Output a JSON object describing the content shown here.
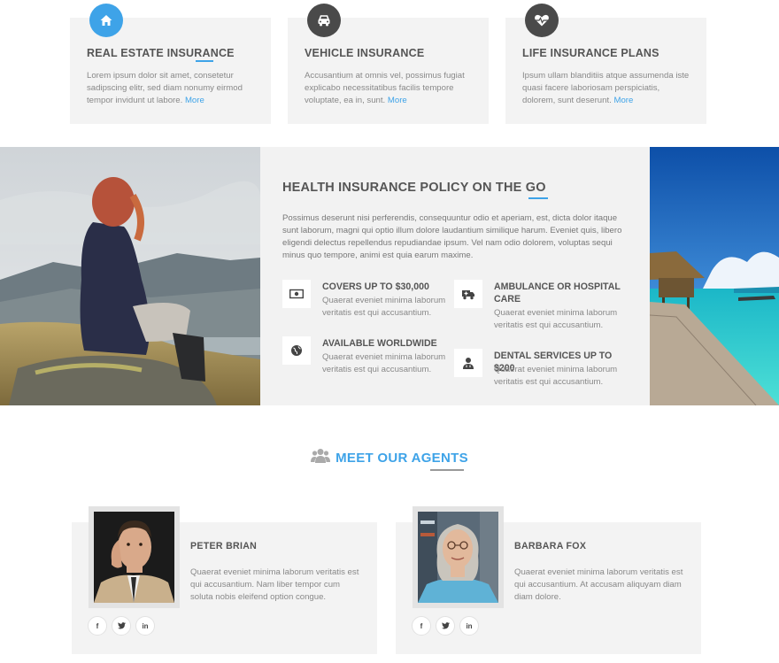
{
  "services": [
    {
      "icon": "home-icon",
      "title": "REAL ESTATE INSURANCE",
      "text": "Lorem ipsum dolor sit amet, consetetur sadipscing elitr, sed diam nonumy eirmod tempor invidunt ut labore.",
      "more": "More"
    },
    {
      "icon": "car-icon",
      "title": "VEHICLE INSURANCE",
      "text": "Accusantium at omnis vel, possimus fugiat explicabo necessitatibus facilis tempore voluptate, ea in, sunt.",
      "more": "More"
    },
    {
      "icon": "heartbeat-icon",
      "title": "LIFE INSURANCE PLANS",
      "text": "Ipsum ullam blanditiis atque assumenda iste quasi facere laboriosam perspiciatis, dolorem, sunt deserunt.",
      "more": "More"
    }
  ],
  "health": {
    "title": "HEALTH INSURANCE POLICY ON THE GO",
    "text": "Possimus deserunt nisi perferendis, consequuntur odio et aperiam, est, dicta dolor itaque sunt laborum, magni qui optio illum dolore laudantium similique harum. Eveniet quis, libero eligendi delectus repellendus repudiandae ipsum. Vel nam odio dolorem, voluptas sequi minus quo tempore, animi est quia earum maxime.",
    "features": [
      {
        "icon": "money-icon",
        "title": "COVERS UP TO $30,000",
        "text": "Quaerat eveniet minima laborum veritatis est qui accusantium."
      },
      {
        "icon": "ambulance-icon",
        "title": "AMBULANCE OR HOSPITAL CARE",
        "text": "Quaerat eveniet minima laborum veritatis est qui accusantium."
      },
      {
        "icon": "globe-icon",
        "title": "AVAILABLE WORLDWIDE",
        "text": "Quaerat eveniet minima laborum veritatis est qui accusantium."
      },
      {
        "icon": "doctor-icon",
        "title": "DENTAL SERVICES UP TO $200",
        "text": "Quaerat eveniet minima laborum veritatis est qui accusantium."
      }
    ]
  },
  "agents_section": {
    "icon": "users-icon",
    "title": "MEET OUR AGENTS"
  },
  "agents": [
    {
      "name": "PETER BRIAN",
      "bio": "Quaerat eveniet minima laborum veritatis est qui accusantium. Nam liber tempor cum soluta nobis eleifend option congue.",
      "socials": [
        "f",
        "t",
        "in"
      ]
    },
    {
      "name": "BARBARA FOX",
      "bio": "Quaerat eveniet minima laborum veritatis est qui accusantium. At accusam aliquyam diam diam dolore.",
      "socials": [
        "f",
        "t",
        "in"
      ]
    }
  ],
  "colors": {
    "accent": "#3ea3e8",
    "dark_icon": "#4a4a4a",
    "card_bg": "#f3f3f3"
  }
}
